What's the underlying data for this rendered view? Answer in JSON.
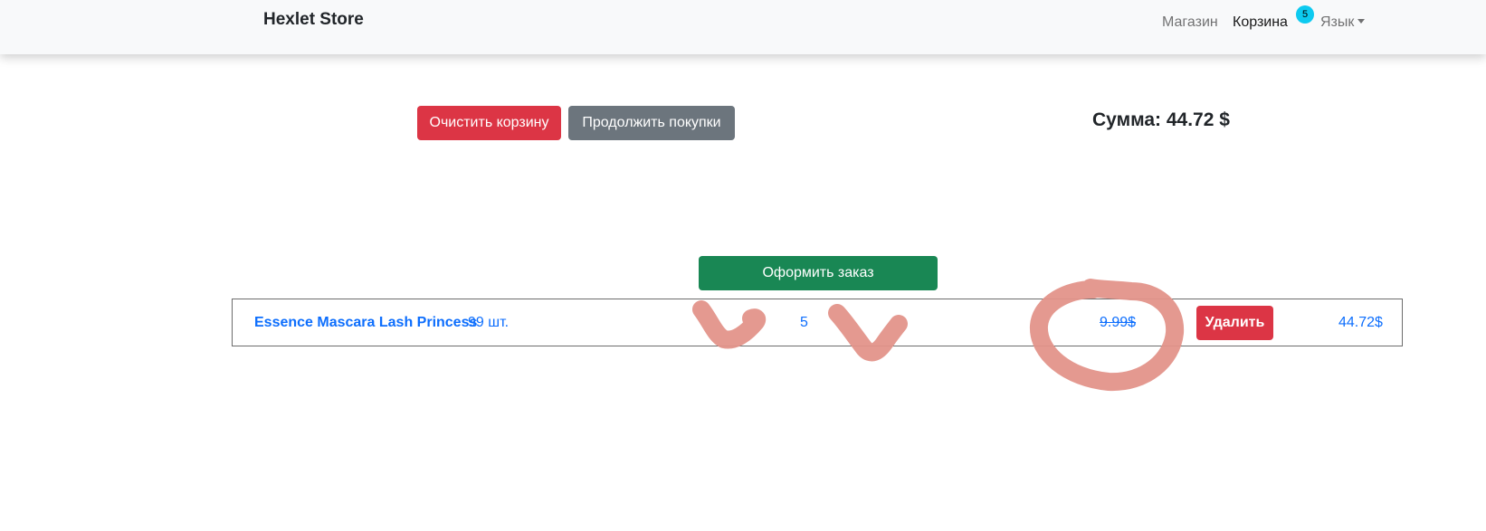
{
  "navbar": {
    "brand": "Hexlet Store",
    "shop_label": "Магазин",
    "cart_label": "Корзина",
    "cart_count": "5",
    "lang_label": "Язык"
  },
  "actions": {
    "clear_cart_label": "Очистить корзину",
    "continue_shopping_label": "Продолжить покупки",
    "total_label": "Сумма: 44.72 $",
    "checkout_label": "Оформить заказ"
  },
  "cart": {
    "items": [
      {
        "name": "Essence Mascara Lash Princess",
        "stock": "99 шт.",
        "quantity": "5",
        "price": "9.99$",
        "delete_label": "Удалить",
        "line_total": "44.72$"
      }
    ]
  },
  "colors": {
    "danger": "#dc3545",
    "secondary": "#6c757d",
    "success": "#198754",
    "link": "#0d6efd",
    "badge": "#0dcaf0",
    "annotation": "#e3938a"
  },
  "icons": {
    "lang_dropdown": "caret-down-icon"
  }
}
